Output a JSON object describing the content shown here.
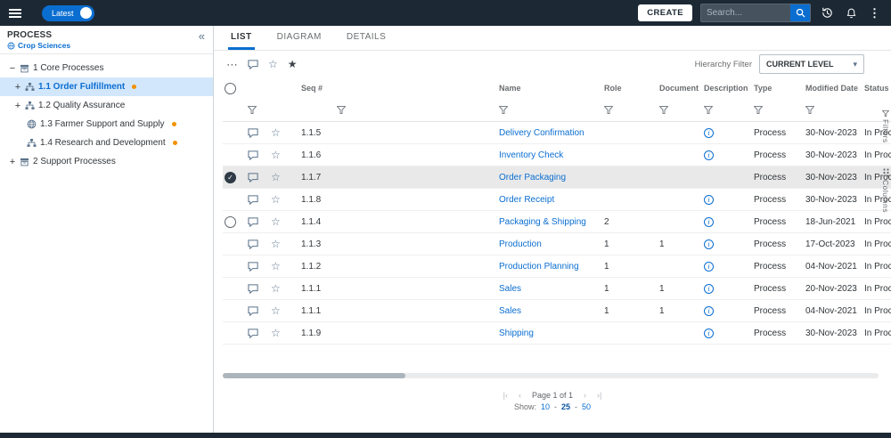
{
  "topbar": {
    "latest_label": "Latest",
    "create_label": "CREATE",
    "search_placeholder": "Search..."
  },
  "icons": {
    "kebab": "⋮",
    "collapse": "«",
    "more": "⋯",
    "star_outline": "☆",
    "star_filled": "★",
    "caret_down": "▾",
    "check": "✓",
    "info": "i",
    "pager_first": "|‹",
    "pager_prev": "‹",
    "pager_next": "›",
    "pager_last": "›|"
  },
  "sidebar": {
    "title": "PROCESS",
    "org": "Crop Sciences",
    "tree": [
      {
        "expander": "−",
        "label": "1 Core Processes"
      },
      {
        "expander": "+",
        "label": "1.1 Order Fulfillment"
      },
      {
        "expander": "+",
        "label": "1.2 Quality Assurance"
      },
      {
        "expander": "",
        "label": "1.3 Farmer Support and Supply"
      },
      {
        "expander": "",
        "label": "1.4 Research and Development"
      },
      {
        "expander": "+",
        "label": "2 Support Processes"
      }
    ]
  },
  "tabs": [
    {
      "label": "LIST"
    },
    {
      "label": "DIAGRAM"
    },
    {
      "label": "DETAILS"
    }
  ],
  "toolbar": {
    "hierarchy_filter_label": "Hierarchy Filter",
    "hierarchy_filter_value": "CURRENT LEVEL"
  },
  "table": {
    "headers": {
      "seq": "Seq #",
      "name": "Name",
      "role": "Role",
      "documents": "Documents",
      "description": "Description",
      "type": "Type",
      "modified": "Modified Date",
      "status": "Status"
    },
    "rows": [
      {
        "seq": "1.1.5",
        "name": "Delivery Confirmation",
        "role": "",
        "documents": "",
        "type": "Process",
        "modified": "30-Nov-2023",
        "status": "In Process"
      },
      {
        "seq": "1.1.6",
        "name": "Inventory Check",
        "role": "",
        "documents": "",
        "type": "Process",
        "modified": "30-Nov-2023",
        "status": "In Process"
      },
      {
        "seq": "1.1.7",
        "name": "Order Packaging",
        "role": "",
        "documents": "",
        "type": "Process",
        "modified": "30-Nov-2023",
        "status": "In Process"
      },
      {
        "seq": "1.1.8",
        "name": "Order Receipt",
        "role": "",
        "documents": "",
        "type": "Process",
        "modified": "30-Nov-2023",
        "status": "In Process"
      },
      {
        "seq": "1.1.4",
        "name": "Packaging & Shipping",
        "role": "2",
        "documents": "",
        "type": "Process",
        "modified": "18-Jun-2021",
        "status": "In Process"
      },
      {
        "seq": "1.1.3",
        "name": "Production",
        "role": "1",
        "documents": "1",
        "type": "Process",
        "modified": "17-Oct-2023",
        "status": "In Process"
      },
      {
        "seq": "1.1.2",
        "name": "Production Planning",
        "role": "1",
        "documents": "",
        "type": "Process",
        "modified": "04-Nov-2021",
        "status": "In Process"
      },
      {
        "seq": "1.1.1",
        "name": "Sales",
        "role": "1",
        "documents": "1",
        "type": "Process",
        "modified": "20-Nov-2023",
        "status": "In Process"
      },
      {
        "seq": "1.1.1",
        "name": "Sales",
        "role": "1",
        "documents": "1",
        "type": "Process",
        "modified": "04-Nov-2021",
        "status": "In Process"
      },
      {
        "seq": "1.1.9",
        "name": "Shipping",
        "role": "",
        "documents": "",
        "type": "Process",
        "modified": "30-Nov-2023",
        "status": "In Process"
      }
    ]
  },
  "pagination": {
    "page_text": "Page 1 of 1",
    "show_label": "Show:",
    "size_10": "10",
    "size_25": "25",
    "size_50": "50",
    "separator": "-"
  },
  "right_rail": {
    "filters_label": "Filters",
    "columns_label": "Columns"
  },
  "colors": {
    "topbar": "#1c2935",
    "accent_blue": "#0a6ed1",
    "selected_row": "#e9e9e9",
    "selected_tree_item": "#d2e7fb",
    "warning_dot": "#f29100"
  }
}
